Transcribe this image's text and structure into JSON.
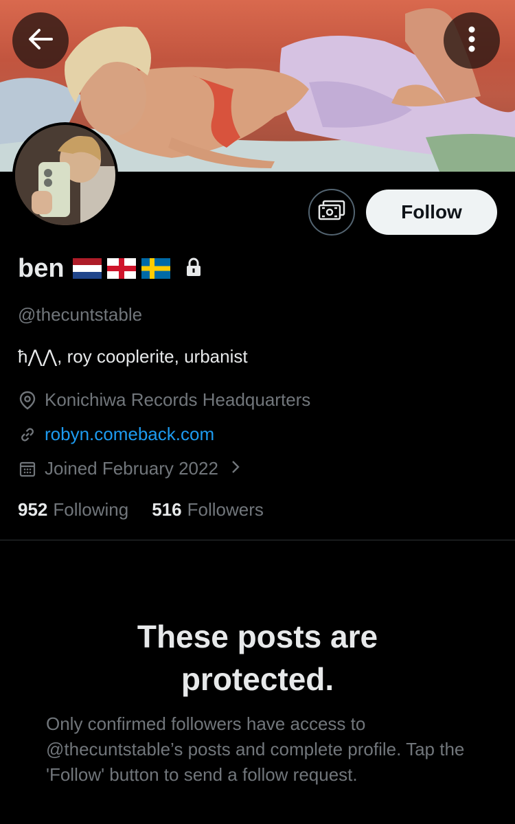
{
  "header": {
    "back_icon": "arrow-left-icon",
    "more_icon": "more-vertical-icon"
  },
  "profile": {
    "display_name": "ben",
    "flags": [
      "netherlands-flag",
      "england-flag",
      "sweden-flag"
    ],
    "protected_icon": "lock-icon",
    "handle": "@thecuntstable",
    "bio": "ħ⋀⋀, roy cooplerite, urbanist",
    "location": "Konichiwa Records Headquarters",
    "website": "robyn.comeback.com",
    "joined": "Joined February 2022",
    "following_count": "952",
    "following_label": "Following",
    "followers_count": "516",
    "followers_label": "Followers"
  },
  "actions": {
    "subscribe_icon": "money-icon",
    "follow_label": "Follow"
  },
  "protected": {
    "title": "These posts are protected.",
    "body": "Only confirmed followers have access to @thecuntstable’s posts and complete profile. Tap the 'Follow' button to send a follow request."
  },
  "colors": {
    "background": "#000000",
    "text_primary": "#e7e9ea",
    "text_secondary": "#71767b",
    "link": "#1d9bf0",
    "follow_button_bg": "#eff3f4"
  }
}
